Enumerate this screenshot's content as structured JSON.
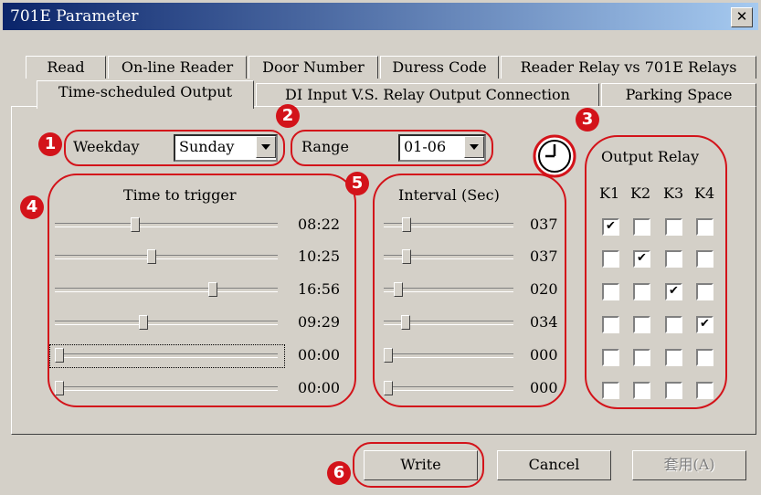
{
  "window": {
    "title": "701E Parameter",
    "close_symbol": "✕"
  },
  "tabs": {
    "row1": [
      "Read",
      "On-line Reader",
      "Door Number",
      "Duress Code",
      "Reader Relay vs 701E Relays"
    ],
    "row2": [
      "Time-scheduled Output",
      "DI Input  V.S. Relay Output Connection",
      "Parking Space"
    ],
    "active": "Time-scheduled Output"
  },
  "weekday": {
    "label": "Weekday",
    "value": "Sunday"
  },
  "range": {
    "label": "Range",
    "value": "01-06"
  },
  "trigger": {
    "header": "Time to trigger",
    "times": [
      "08:22",
      "10:25",
      "16:56",
      "09:29",
      "00:00",
      "00:00"
    ],
    "slider_fraction": [
      0.35,
      0.43,
      0.71,
      0.39,
      0.0,
      0.0
    ]
  },
  "interval": {
    "header": "Interval (Sec)",
    "values": [
      "037",
      "037",
      "020",
      "034",
      "000",
      "000"
    ],
    "slider_fraction": [
      0.15,
      0.15,
      0.08,
      0.14,
      0.0,
      0.0
    ]
  },
  "output_relay": {
    "header": "Output Relay",
    "columns": [
      "K1",
      "K2",
      "K3",
      "K4"
    ],
    "checked": [
      [
        true,
        false,
        false,
        false
      ],
      [
        false,
        true,
        false,
        false
      ],
      [
        false,
        false,
        true,
        false
      ],
      [
        false,
        false,
        false,
        true
      ],
      [
        false,
        false,
        false,
        false
      ],
      [
        false,
        false,
        false,
        false
      ]
    ]
  },
  "markers": [
    "1",
    "2",
    "3",
    "4",
    "5",
    "6"
  ],
  "buttons": {
    "write": "Write",
    "cancel": "Cancel",
    "apply": "套用(A)"
  },
  "colors": {
    "highlight": "#d3131a",
    "title_start": "#0a246a",
    "title_end": "#a6caf0"
  }
}
